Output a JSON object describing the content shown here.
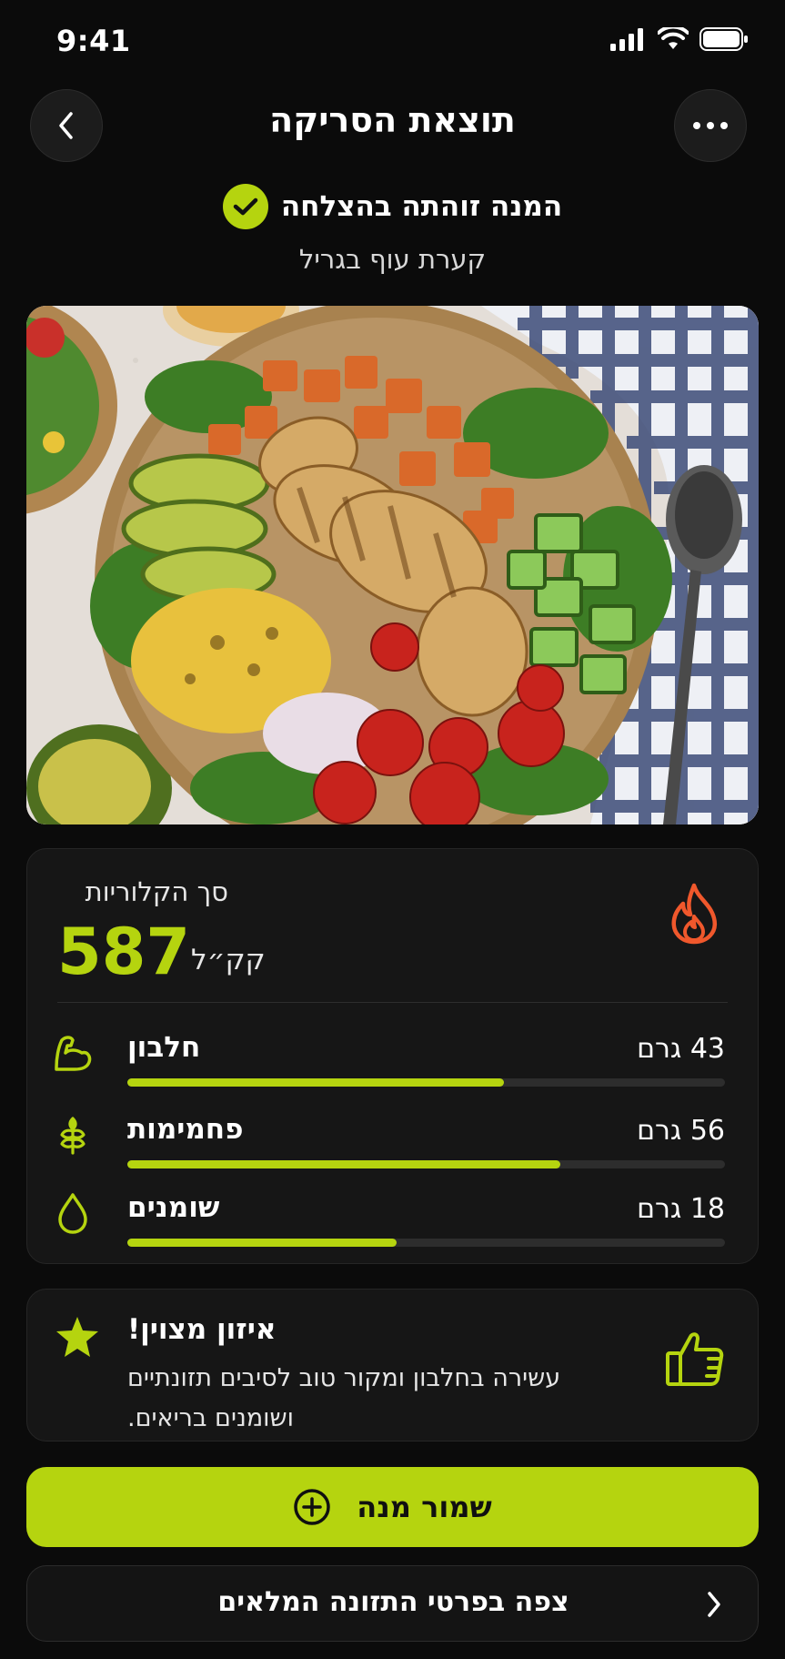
{
  "status_bar": {
    "time": "9:41"
  },
  "header": {
    "title": "תוצאת הסריקה"
  },
  "result": {
    "success_text": "המנה זוהתה בהצלחה",
    "dish_name": "קערת עוף בגריל"
  },
  "calories": {
    "label": "סך הקלוריות",
    "value": "587",
    "unit": "קק״ל"
  },
  "macros": [
    {
      "name": "חלבון",
      "amount": "43 גרם",
      "icon": "muscle-icon",
      "progress": 0.63
    },
    {
      "name": "פחמימות",
      "amount": "56 גרם",
      "icon": "wheat-icon",
      "progress": 0.725
    },
    {
      "name": "שומנים",
      "amount": "18 גרם",
      "icon": "drop-icon",
      "progress": 0.45
    }
  ],
  "tip": {
    "title": "איזון מצוין!",
    "text": "עשירה בחלבון ומקור טוב לסיבים תזונתיים ושומנים בריאים."
  },
  "actions": {
    "save_label": "שמור מנה",
    "details_label": "צפה בפרטי התזונה המלאים"
  },
  "colors": {
    "accent": "#b5d40f",
    "background": "#0b0b0b",
    "card": "#161616",
    "flame": "#f0582c"
  }
}
